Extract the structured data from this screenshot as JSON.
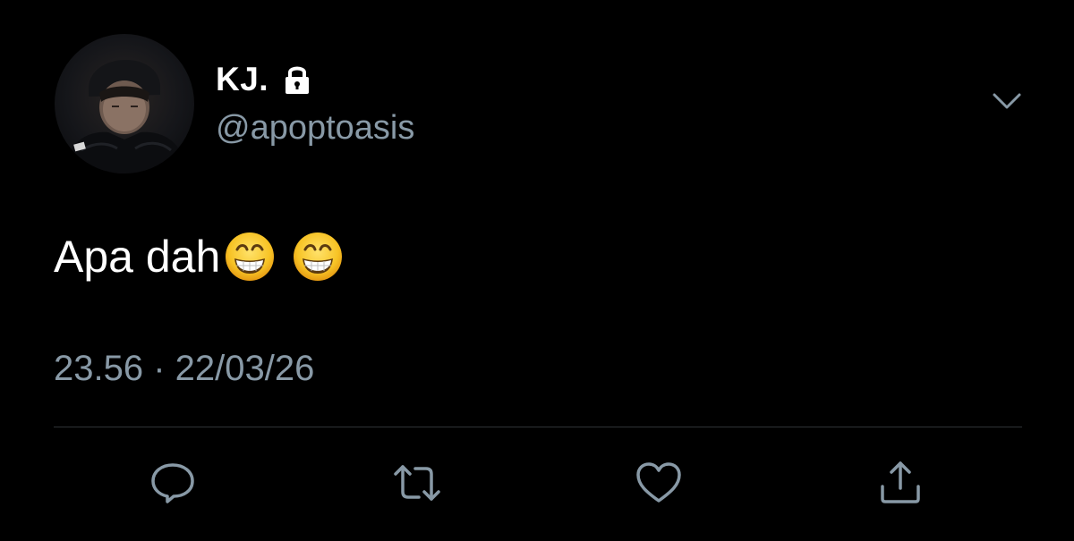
{
  "tweet": {
    "display_name": "KJ.",
    "handle": "@apoptoasis",
    "text": "Apa dah",
    "emojis": [
      "grinning-face-with-smiling-eyes",
      "grinning-face-with-smiling-eyes"
    ],
    "timestamp": "23.56 · 22/03/26",
    "protected": true
  },
  "icons": {
    "lock": "lock-icon",
    "menu": "chevron-down-icon",
    "reply": "reply-icon",
    "retweet": "retweet-icon",
    "like": "heart-icon",
    "share": "share-icon"
  },
  "colors": {
    "background": "#000000",
    "primary_text": "#ffffff",
    "secondary_text": "#8899a6",
    "divider": "#2f3336",
    "action_icon": "#8899a6"
  }
}
